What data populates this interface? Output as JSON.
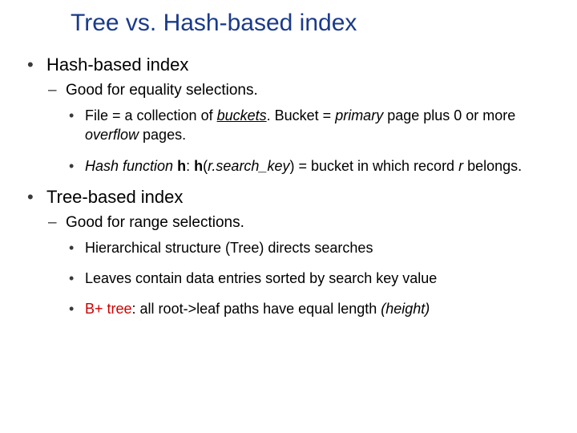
{
  "title": "Tree vs. Hash-based index",
  "sections": [
    {
      "heading": "Hash-based index",
      "sub": [
        {
          "label": "Good for equality selections.",
          "points": [
            {
              "pre1": "File = a collection of ",
              "buckets": "buckets",
              "mid1": ". Bucket = ",
              "primary": "primary",
              "mid2": " page plus 0 or more ",
              "overflow": "overflow",
              "post1": " pages."
            },
            {
              "hashfn": "Hash function",
              "h1": " h",
              "colon": ":  ",
              "h2": "h",
              "lparen": "(",
              "rsk": "r.search_key",
              "rparen": ")",
              "eq": " = bucket in which record ",
              "r": "r",
              "tail": " belongs."
            }
          ]
        }
      ]
    },
    {
      "heading": "Tree-based index",
      "sub": [
        {
          "label": "Good for range selections.",
          "points": [
            {
              "text": "Hierarchical structure (Tree) directs searches"
            },
            {
              "text": "Leaves contain data entries sorted by search key value"
            },
            {
              "bplus_pre": "B+ tree",
              "bplus_mid": ": all root->leaf paths have equal length ",
              "bplus_height": "(height)"
            }
          ]
        }
      ]
    }
  ]
}
